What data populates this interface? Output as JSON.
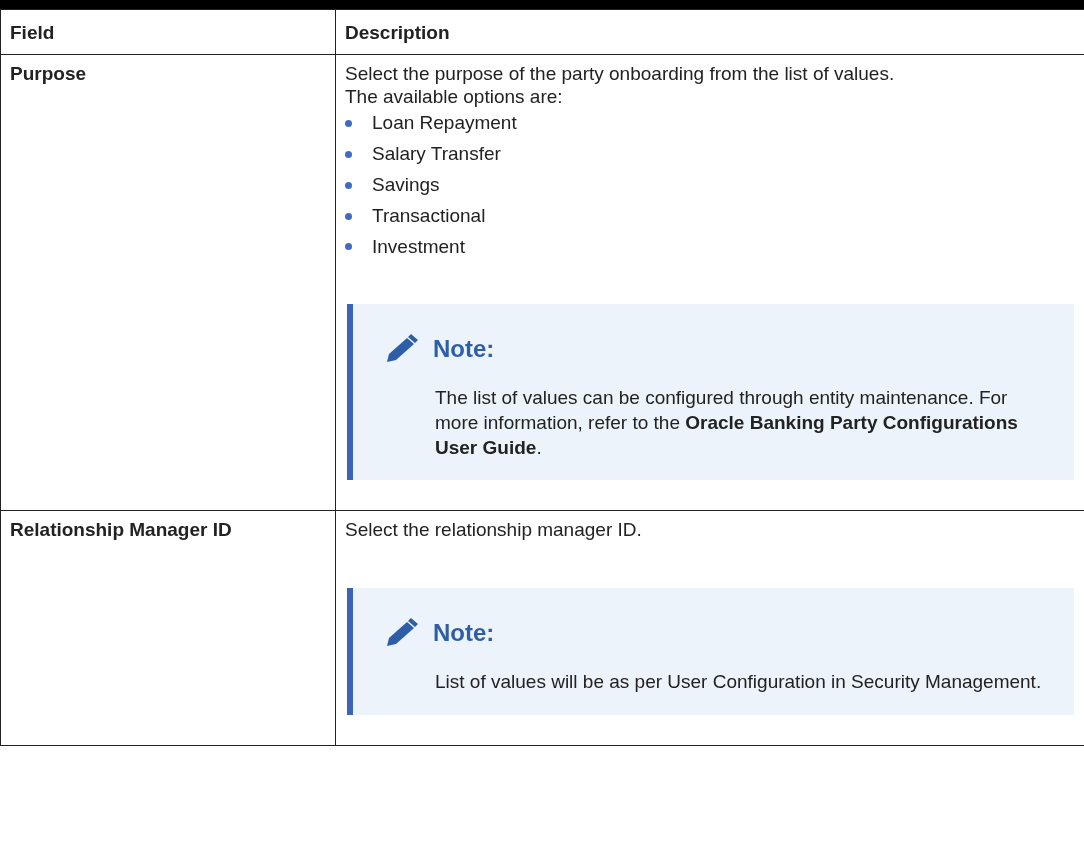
{
  "table": {
    "columns": [
      "Field",
      "Description"
    ],
    "rows": [
      {
        "field": "Purpose",
        "paragraphs": [
          "Select the purpose of the party onboarding from the list of values.",
          "The available options are:"
        ],
        "options": [
          "Loan Repayment",
          "Salary Transfer",
          "Savings",
          "Transactional",
          "Investment"
        ],
        "note": {
          "title": "Note:",
          "text": "The list of values can be configured through entity maintenance. For more information, refer to the **Oracle Banking Party Configurations User Guide**."
        }
      },
      {
        "field": "Relationship Manager ID",
        "paragraphs": [
          "Select the relationship manager ID."
        ],
        "note": {
          "title": "Note:",
          "text": "List of values will be as per User Configuration in Security Management."
        }
      }
    ]
  }
}
